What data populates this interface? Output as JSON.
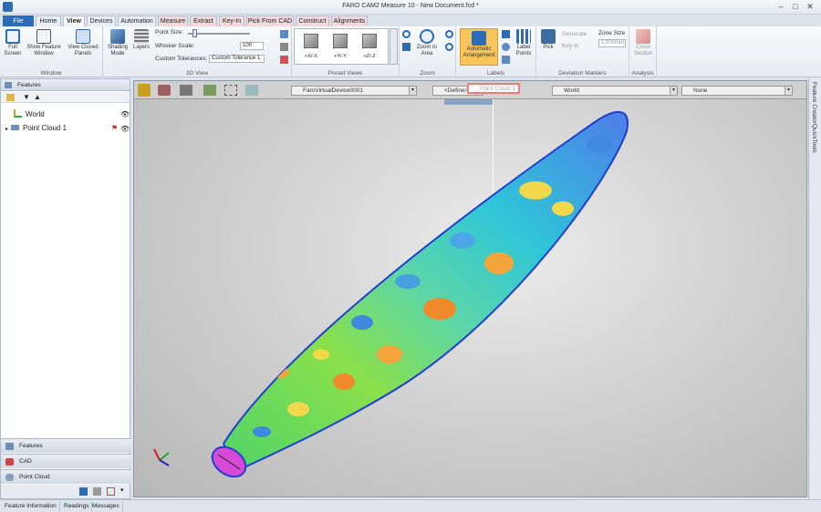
{
  "window": {
    "title": "FARO CAM2 Measure 10 - New Document.fcd *",
    "minimize": "–",
    "maximize": "□",
    "close": "✕"
  },
  "tabs": [
    "File",
    "Home",
    "View",
    "Devices",
    "Automation",
    "Measure",
    "Extract",
    "Key-In",
    "Pick From CAD",
    "Construct",
    "Alignments"
  ],
  "ribbon": {
    "window_group": {
      "label": "Window",
      "full_screen": "Full Screen",
      "show_feature_window": "Show Feature Window",
      "view_closed_panels": "View Closed Panels"
    },
    "view3d_group": {
      "label": "3D View",
      "shading_mode": "Shading Mode",
      "layers": "Layers",
      "point_size_label": "Point Size:",
      "whisker_scale_label": "Whisker Scale:",
      "whisker_scale_value": "100",
      "custom_tolerances_label": "Custom Tolerances:",
      "custom_tolerances_value": "Custom Tolerance 1"
    },
    "preset_views": {
      "label": "Preset Views",
      "views": [
        "+X/-X",
        "+Y/-Y",
        "+Z/-Z"
      ]
    },
    "zoom": {
      "label": "Zoom",
      "zoom_to_area": "Zoom to Area"
    },
    "labels": {
      "label": "Labels",
      "automatic_arrangement": "Automatic Arrangement",
      "label_points": "Label Points"
    },
    "deviation": {
      "label": "Deviation Markers",
      "pick": "Pick",
      "generate": "Generate",
      "key_in": "Key In",
      "zone_size_label": "Zone Size",
      "zone_size_value": "1.000mm"
    },
    "analysis": {
      "label": "Analysis",
      "cross_section": "Cross Section"
    }
  },
  "features_panel": {
    "title": "Features",
    "items": [
      {
        "label": "World"
      },
      {
        "label": "Point Cloud 1"
      }
    ]
  },
  "bottom_panels": [
    "Features",
    "CAD",
    "Point Cloud"
  ],
  "viewport": {
    "device": "FaroVirtualDevice0001",
    "define": "<Define>",
    "selection": "Point Cloud 1",
    "frame": "World",
    "none": "None"
  },
  "right_tabs": [
    "Feature Creator",
    "QuickTools"
  ],
  "status_tabs": [
    "Feature Information",
    "Readings",
    "Messages"
  ],
  "colors": {
    "accent": "#2d6ab7",
    "highlight": "#f6c45a"
  }
}
